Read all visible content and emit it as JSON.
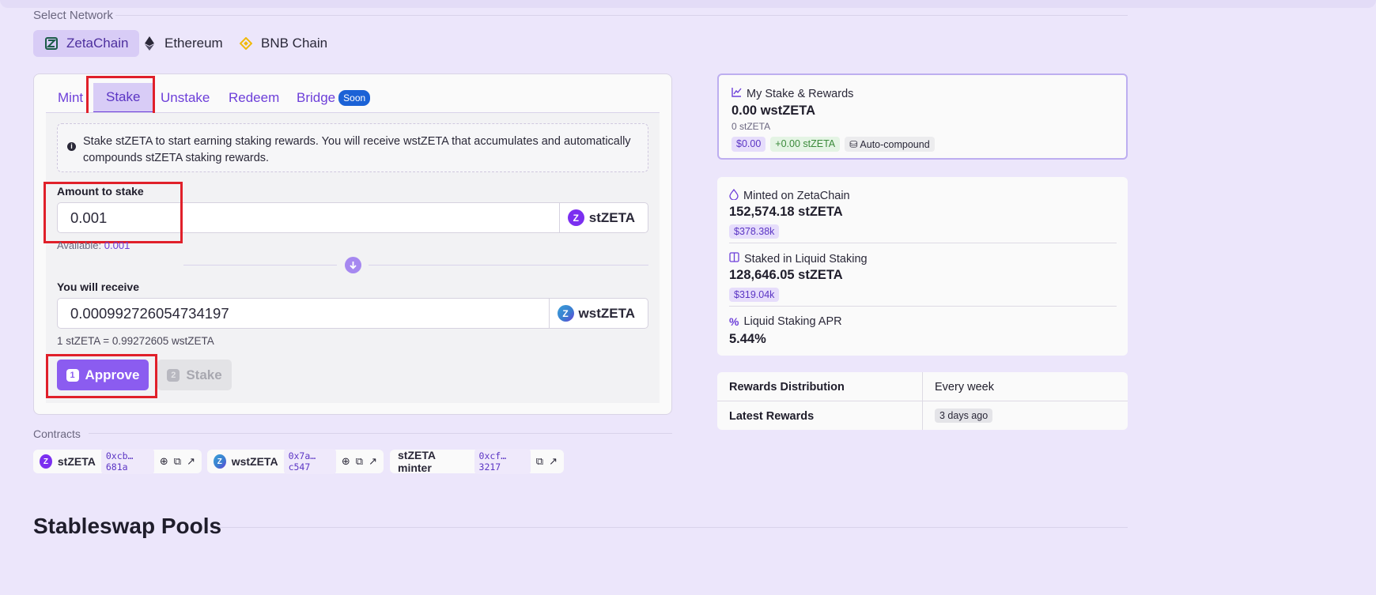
{
  "network": {
    "label": "Select Network",
    "tabs": [
      {
        "label": "ZetaChain",
        "icon": "zetachain-icon",
        "active": true
      },
      {
        "label": "Ethereum",
        "icon": "ethereum-icon",
        "active": false
      },
      {
        "label": "BNB Chain",
        "icon": "bnb-chain-icon",
        "active": false
      }
    ]
  },
  "action_tabs": [
    {
      "label": "Mint"
    },
    {
      "label": "Stake",
      "active": true
    },
    {
      "label": "Unstake"
    },
    {
      "label": "Redeem"
    },
    {
      "label": "Bridge",
      "badge": "Soon"
    }
  ],
  "stake": {
    "info": "Stake stZETA to start earning staking rewards. You will receive wstZETA that accumulates and automatically compounds stZETA staking rewards.",
    "amount_label": "Amount to stake",
    "amount_value": "0.001",
    "amount_token": "stZETA",
    "available_label": "Available:",
    "available_value": "0.001",
    "receive_label": "You will receive",
    "receive_value": "0.000992726054734197",
    "receive_token": "wstZETA",
    "rate": "1 stZETA = 0.99272605 wstZETA",
    "approve_step": "1",
    "approve_label": "Approve",
    "stake_step": "2",
    "stake_label": "Stake"
  },
  "my_stake": {
    "title": "My Stake & Rewards",
    "value": "0.00 wstZETA",
    "sub": "0 stZETA",
    "usd": "$0.00",
    "gain": "+0.00 stZETA",
    "compound": "Auto-compound"
  },
  "stats": [
    {
      "title": "Minted on ZetaChain",
      "value": "152,574.18 stZETA",
      "usd": "$378.38k",
      "icon": "drop-icon"
    },
    {
      "title": "Staked in Liquid Staking",
      "value": "128,646.05 stZETA",
      "usd": "$319.04k",
      "icon": "book-icon"
    },
    {
      "title": "Liquid Staking APR",
      "value": "5.44%",
      "icon": "percent-icon"
    }
  ],
  "rewards_table": [
    {
      "label": "Rewards Distribution",
      "value": "Every week"
    },
    {
      "label": "Latest Rewards",
      "value": "3 days ago"
    }
  ],
  "contracts": {
    "label": "Contracts",
    "items": [
      {
        "name": "stZETA",
        "address": "0xcb…681a"
      },
      {
        "name": "wstZETA",
        "address": "0x7a…c547"
      },
      {
        "name": "stZETA minter",
        "address": "0xcf…3217"
      }
    ]
  },
  "stableswap": {
    "title": "Stableswap Pools"
  },
  "colors": {
    "accent": "#6d3fd9",
    "button": "#8b5cf0",
    "highlight": "#e0202a",
    "background": "#ece6fb"
  }
}
